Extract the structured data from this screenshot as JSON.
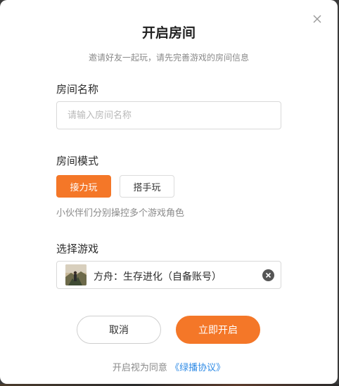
{
  "dialog": {
    "title": "开启房间",
    "subtitle": "邀请好友一起玩，请先完善游戏的房间信息",
    "close_icon": "close-icon"
  },
  "room_name": {
    "label": "房间名称",
    "value": "",
    "placeholder": "请输入房间名称"
  },
  "room_mode": {
    "label": "房间模式",
    "options": [
      "接力玩",
      "搭手玩"
    ],
    "selected": "接力玩",
    "hint": "小伙伴们分别操控多个游戏角色"
  },
  "game": {
    "label": "选择游戏",
    "selected_name": "方舟：生存进化（自备账号）",
    "thumbnail_icon": "game-thumbnail",
    "clear_icon": "clear-icon"
  },
  "actions": {
    "cancel_label": "取消",
    "start_label": "立即开启"
  },
  "agreement": {
    "prefix": "开启视为同意",
    "link_text": "《绿播协议》"
  },
  "colors": {
    "accent": "#f47728",
    "link": "#2f8be6"
  }
}
